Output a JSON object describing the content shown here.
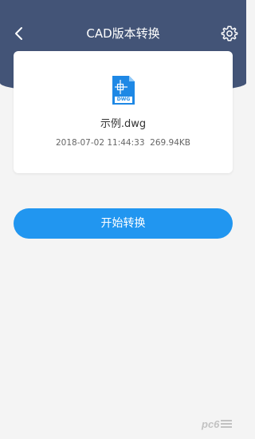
{
  "header": {
    "title": "CAD版本转换",
    "back_icon": "chevron-left-icon",
    "settings_icon": "gear-icon",
    "bg_color": "#435477"
  },
  "file_card": {
    "file_name": "示例.dwg",
    "meta": "2018-07-02 11:44:33  269.94KB",
    "icon": "dwg-file-icon",
    "icon_label": "DWG"
  },
  "actions": {
    "convert_label": "开始转换",
    "accent_color": "#2196f0"
  },
  "watermark": {
    "text": "pc6",
    "icon": "pc6-logo"
  }
}
